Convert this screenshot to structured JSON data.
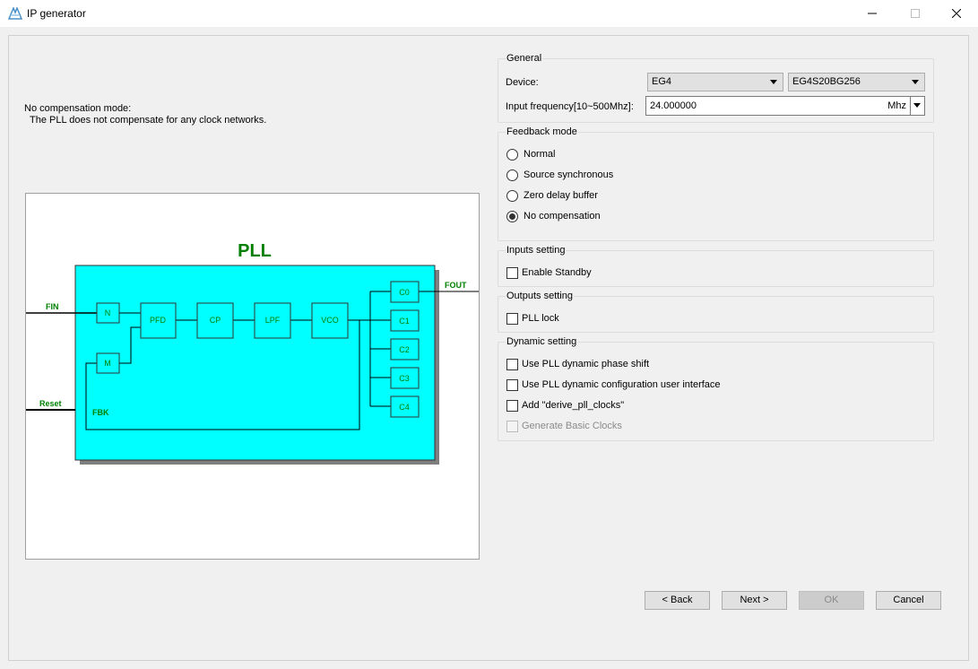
{
  "window": {
    "title": "IP generator",
    "icon": "app-logo-icon"
  },
  "description": {
    "line1": "No compensation mode:",
    "line2": "The PLL does not compensate for any clock networks."
  },
  "diagram": {
    "title": "PLL",
    "signals": {
      "fin": "FIN",
      "fout": "FOUT",
      "reset": "Reset",
      "fbk": "FBK"
    },
    "blocks": {
      "n": "N",
      "m": "M",
      "pfd": "PFD",
      "cp": "CP",
      "lpf": "LPF",
      "vco": "VCO"
    },
    "outputs": [
      "C0",
      "C1",
      "C2",
      "C3",
      "C4"
    ],
    "colors": {
      "body": "#00ffff",
      "text": "#008000",
      "shadow": "#7f7f7f"
    }
  },
  "general": {
    "title": "General",
    "device_label": "Device:",
    "device_family": "EG4",
    "device_part": "EG4S20BG256",
    "freq_label": "Input frequency[10~500Mhz]:",
    "freq_value": "24.000000",
    "freq_unit": "Mhz"
  },
  "feedback": {
    "title": "Feedback mode",
    "options": [
      "Normal",
      "Source synchronous",
      "Zero delay buffer",
      "No compensation"
    ],
    "selected": "No compensation"
  },
  "inputs": {
    "title": "Inputs setting",
    "enable_standby": "Enable Standby"
  },
  "outputs": {
    "title": "Outputs setting",
    "pll_lock": "PLL lock"
  },
  "dynamic": {
    "title": "Dynamic setting",
    "phase_shift": "Use PLL dynamic phase shift",
    "config_ui": "Use PLL dynamic configuration user interface",
    "derive_clocks": "Add \"derive_pll_clocks\"",
    "basic_clocks": "Generate Basic Clocks"
  },
  "buttons": {
    "back": "< Back",
    "next": "Next >",
    "ok": "OK",
    "cancel": "Cancel"
  }
}
